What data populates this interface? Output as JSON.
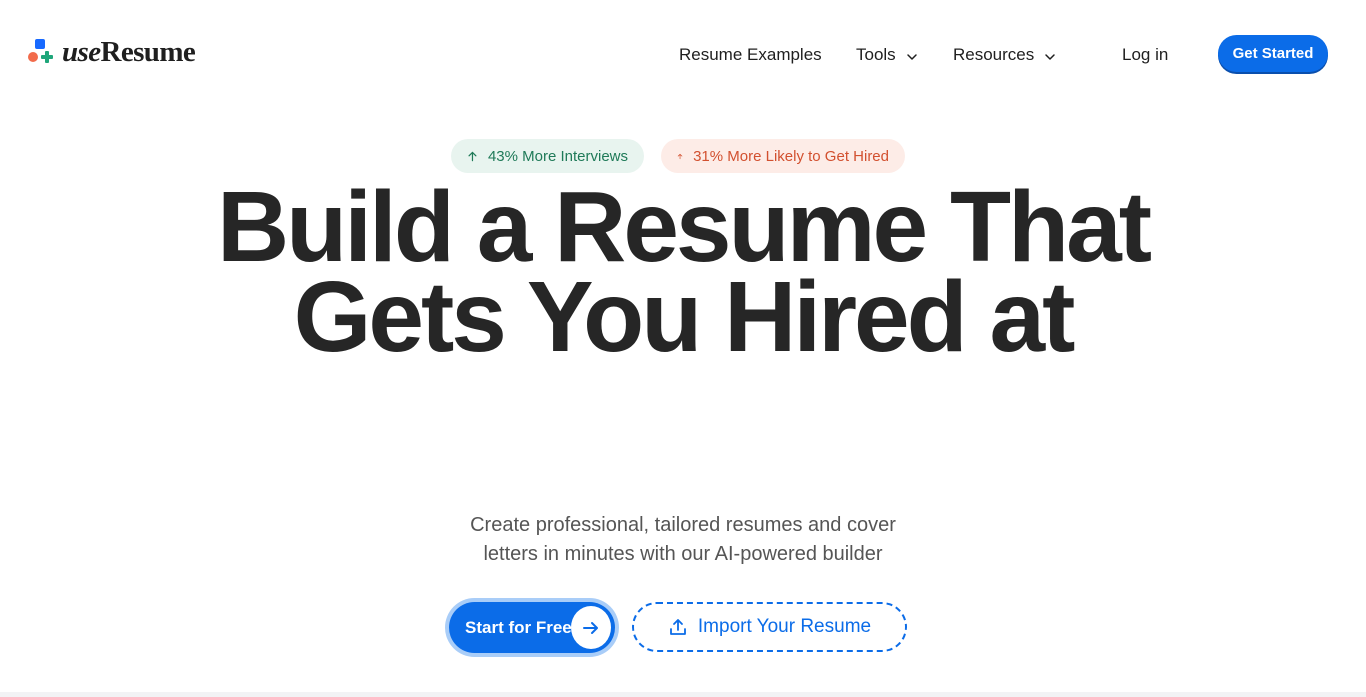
{
  "brand": {
    "logo_prefix": "use",
    "logo_suffix": "Resume",
    "colors": {
      "blue": "#1769ff",
      "orange": "#f26b4b",
      "green": "#1fa67a"
    }
  },
  "nav": {
    "items": [
      {
        "label": "Resume Examples",
        "has_dropdown": false
      },
      {
        "label": "Tools",
        "has_dropdown": true
      },
      {
        "label": "Resources",
        "has_dropdown": true
      }
    ],
    "login_label": "Log in",
    "cta_label": "Get Started"
  },
  "badges": [
    {
      "text": "43% More Interviews",
      "icon": "arrow-up-icon",
      "color": "#1f7a58"
    },
    {
      "text": "31% More Likely to Get Hired",
      "icon": "arrow-up-icon",
      "color": "#d2502f"
    }
  ],
  "hero": {
    "headline_line1": "Build a Resume That",
    "headline_line2": "Gets You Hired at",
    "subtitle_line1": "Create professional, tailored resumes and cover",
    "subtitle_line2": "letters in minutes with our AI-powered builder",
    "primary_cta": "Start for Free",
    "secondary_cta": "Import Your Resume",
    "accent_color": "#0b6ce8"
  }
}
